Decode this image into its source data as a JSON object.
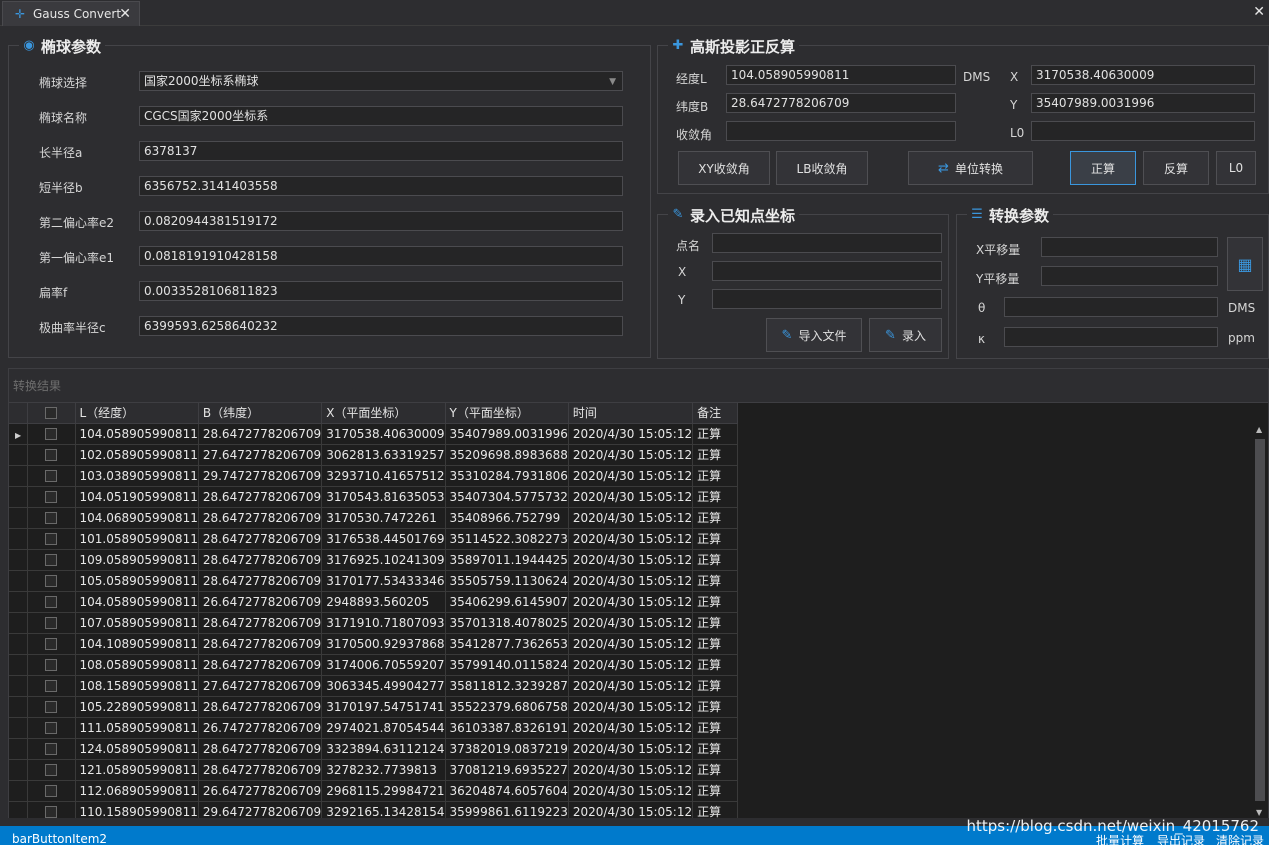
{
  "tab": {
    "title": "Gauss Convert",
    "close": "✕"
  },
  "ellipsoid": {
    "title": "椭球参数",
    "select_label": "椭球选择",
    "select_value": "国家2000坐标系椭球",
    "name_label": "椭球名称",
    "name_value": "CGCS国家2000坐标系",
    "a_label": "长半径a",
    "a_value": "6378137",
    "b_label": "短半径b",
    "b_value": "6356752.3141403558",
    "e2_label": "第二偏心率e2",
    "e2_value": "0.0820944381519172",
    "e1_label": "第一偏心率e1",
    "e1_value": "0.0818191910428158",
    "f_label": "扁率f",
    "f_value": "0.0033528106811823",
    "c_label": "极曲率半径c",
    "c_value": "6399593.6258640232"
  },
  "gauss": {
    "title": "高斯投影正反算",
    "lon_label": "经度L",
    "lon_value": "104.058905990811",
    "lat_label": "纬度B",
    "lat_value": "28.6472778206709",
    "conv_label": "收敛角",
    "conv_value": "",
    "dms_label": "DMS",
    "x_label": "X",
    "x_value": "3170538.40630009",
    "y_label": "Y",
    "y_value": "35407989.0031996",
    "l0_label": "L0",
    "l0_value": "",
    "btn_xy": "XY收敛角",
    "btn_lb": "LB收敛角",
    "btn_unit": "单位转换",
    "btn_forward": "正算",
    "btn_inverse": "反算",
    "btn_l0": "L0"
  },
  "known_point": {
    "title": "录入已知点坐标",
    "name_label": "点名",
    "x_label": "X",
    "y_label": "Y",
    "btn_import": "导入文件",
    "btn_enter": "录入"
  },
  "transform": {
    "title": "转换参数",
    "dx_label": "X平移量",
    "dy_label": "Y平移量",
    "theta_label": "θ",
    "theta_unit": "DMS",
    "k_label": "κ",
    "k_unit": "ppm"
  },
  "results": {
    "title": "转换结果",
    "columns": [
      "L（经度）",
      "B（纬度）",
      "X（平面坐标）",
      "Y（平面坐标）",
      "时间",
      "备注"
    ],
    "rows": [
      [
        "104.058905990811",
        "28.6472778206709",
        "3170538.40630009",
        "35407989.0031996",
        "2020/4/30 15:05:12",
        "正算"
      ],
      [
        "102.058905990811",
        "27.6472778206709",
        "3062813.63319257",
        "35209698.8983688",
        "2020/4/30 15:05:12",
        "正算"
      ],
      [
        "103.038905990811",
        "29.7472778206709",
        "3293710.41657512",
        "35310284.7931806",
        "2020/4/30 15:05:12",
        "正算"
      ],
      [
        "104.051905990811",
        "28.6472778206709",
        "3170543.81635053",
        "35407304.5775732",
        "2020/4/30 15:05:12",
        "正算"
      ],
      [
        "104.068905990811",
        "28.6472778206709",
        "3170530.7472261",
        "35408966.752799",
        "2020/4/30 15:05:12",
        "正算"
      ],
      [
        "101.058905990811",
        "28.6472778206709",
        "3176538.44501769",
        "35114522.3082273",
        "2020/4/30 15:05:12",
        "正算"
      ],
      [
        "109.058905990811",
        "28.6472778206709",
        "3176925.10241309",
        "35897011.1944425",
        "2020/4/30 15:05:12",
        "正算"
      ],
      [
        "105.058905990811",
        "28.6472778206709",
        "3170177.53433346",
        "35505759.1130624",
        "2020/4/30 15:05:12",
        "正算"
      ],
      [
        "104.058905990811",
        "26.6472778206709",
        "2948893.560205",
        "35406299.6145907",
        "2020/4/30 15:05:12",
        "正算"
      ],
      [
        "107.058905990811",
        "28.6472778206709",
        "3171910.71807093",
        "35701318.4078025",
        "2020/4/30 15:05:12",
        "正算"
      ],
      [
        "104.108905990811",
        "28.6472778206709",
        "3170500.92937868",
        "35412877.7362653",
        "2020/4/30 15:05:12",
        "正算"
      ],
      [
        "108.058905990811",
        "28.6472778206709",
        "3174006.70559207",
        "35799140.0115824",
        "2020/4/30 15:05:12",
        "正算"
      ],
      [
        "108.158905990811",
        "27.6472778206709",
        "3063345.49904277",
        "35811812.3239287",
        "2020/4/30 15:05:12",
        "正算"
      ],
      [
        "105.228905990811",
        "28.6472778206709",
        "3170197.54751741",
        "35522379.6806758",
        "2020/4/30 15:05:12",
        "正算"
      ],
      [
        "111.058905990811",
        "26.7472778206709",
        "2974021.87054544",
        "36103387.8326191",
        "2020/4/30 15:05:12",
        "正算"
      ],
      [
        "124.058905990811",
        "28.6472778206709",
        "3323894.63112124",
        "37382019.0837219",
        "2020/4/30 15:05:12",
        "正算"
      ],
      [
        "121.058905990811",
        "28.6472778206709",
        "3278232.7739813",
        "37081219.6935227",
        "2020/4/30 15:05:12",
        "正算"
      ],
      [
        "112.068905990811",
        "26.6472778206709",
        "2968115.29984721",
        "36204874.6057604",
        "2020/4/30 15:05:12",
        "正算"
      ],
      [
        "110.158905990811",
        "29.6472778206709",
        "3292165.13428154",
        "35999861.6119223",
        "2020/4/30 15:05:12",
        "正算"
      ]
    ]
  },
  "statusbar": {
    "left": "barButtonItem2",
    "batch": "批量计算",
    "export": "导出记录",
    "clear": "清除记录"
  },
  "watermark": "https://blog.csdn.net/weixin_42015762",
  "colors": {
    "accent": "#007acc",
    "icon": "#3a96dd",
    "background": "#2d2d30",
    "grid": "#1e1e1e"
  }
}
